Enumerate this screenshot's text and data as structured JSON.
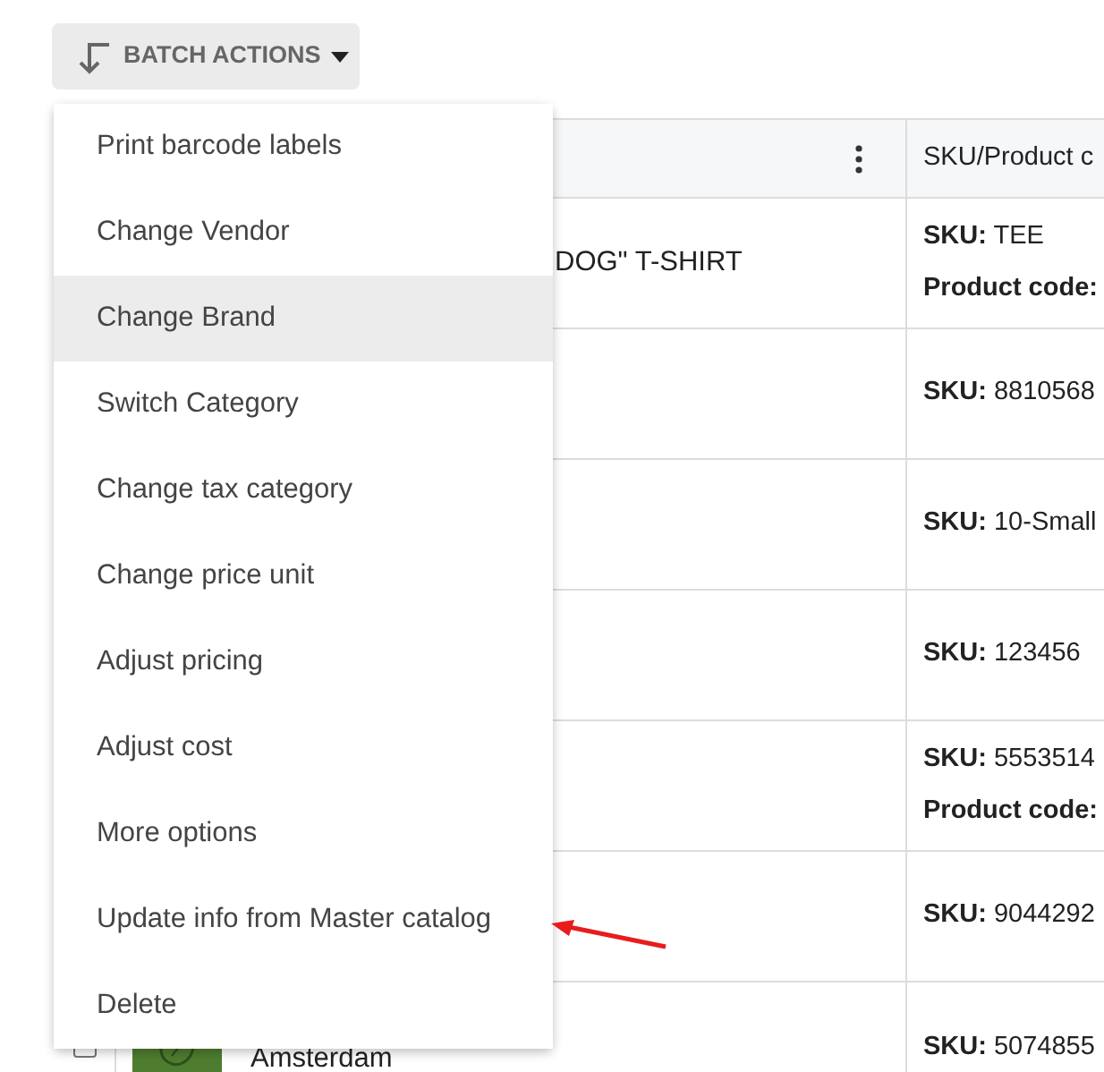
{
  "batch_button": {
    "label": "BATCH ACTIONS"
  },
  "menu": {
    "items": [
      {
        "label": "Print barcode labels",
        "highlighted": false
      },
      {
        "label": "Change Vendor",
        "highlighted": false
      },
      {
        "label": "Change Brand",
        "highlighted": true
      },
      {
        "label": "Switch Category",
        "highlighted": false
      },
      {
        "label": "Change tax category",
        "highlighted": false
      },
      {
        "label": "Change price unit",
        "highlighted": false
      },
      {
        "label": "Adjust pricing",
        "highlighted": false
      },
      {
        "label": "Adjust cost",
        "highlighted": false
      },
      {
        "label": "More options",
        "highlighted": false
      },
      {
        "label": "Update info from Master catalog",
        "highlighted": false
      },
      {
        "label": "Delete",
        "highlighted": false
      }
    ]
  },
  "table": {
    "header_label": "SKU/Product c",
    "rows": [
      {
        "name": "DOG\" T-SHIRT",
        "sku": [
          "**SKU:** TEE",
          "**Product code:**"
        ]
      },
      {
        "sku": [
          "**SKU:** 8810568"
        ]
      },
      {
        "sku": [
          "**SKU:** 10-Small"
        ]
      },
      {
        "sku": [
          "**SKU:** 123456"
        ]
      },
      {
        "sku": [
          "**SKU:** 5553514",
          "**Product code:**"
        ]
      },
      {
        "sku": [
          "**SKU:** 9044292"
        ]
      },
      {
        "name": "Amsterdam",
        "checked": false,
        "thumbnail": {
          "kind": "picture"
        },
        "sku": [
          "**SKU:** 5074855"
        ]
      }
    ]
  }
}
